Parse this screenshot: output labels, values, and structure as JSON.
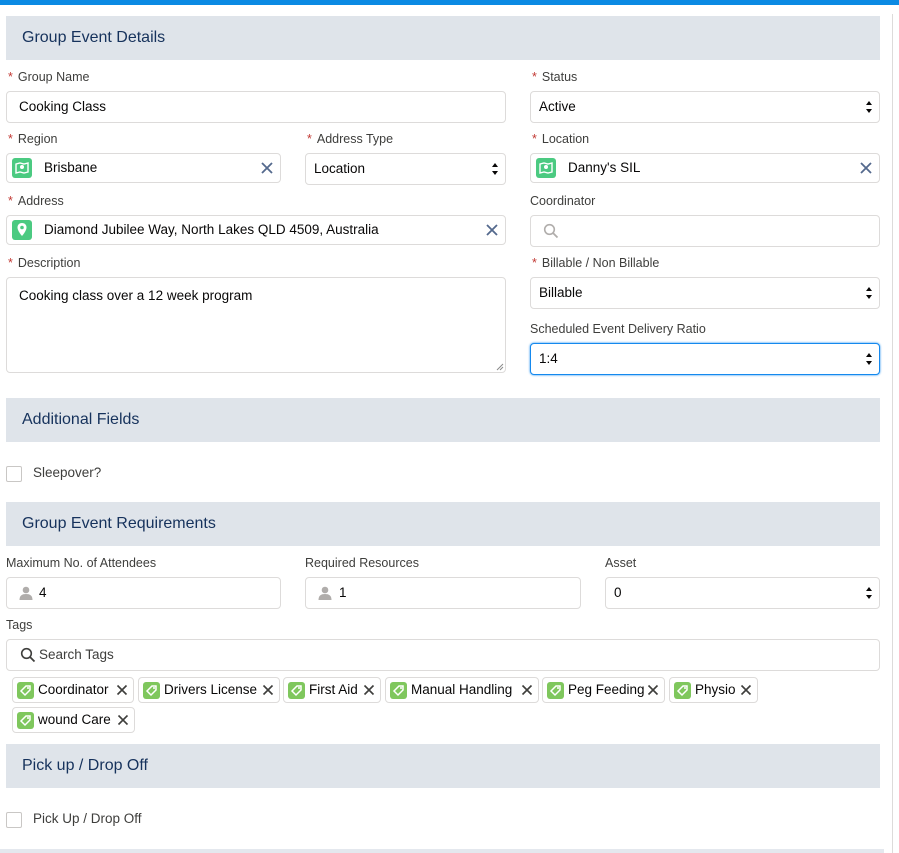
{
  "sections": {
    "group_event_details": "Group Event Details",
    "additional_fields": "Additional Fields",
    "requirements": "Group Event Requirements",
    "pickup": "Pick up / Drop Off"
  },
  "required_marker": "*",
  "group_name": {
    "label": "Group Name",
    "value": "Cooking Class"
  },
  "status": {
    "label": "Status",
    "value": "Active"
  },
  "region": {
    "label": "Region",
    "value": "Brisbane",
    "icon": "location-record-icon"
  },
  "address_type": {
    "label": "Address Type",
    "value": "Location"
  },
  "location": {
    "label": "Location",
    "value": "Danny's SIL",
    "icon": "location-record-icon"
  },
  "address": {
    "label": "Address",
    "value": "Diamond Jubilee Way, North Lakes QLD 4509, Australia",
    "icon": "map-pin-icon"
  },
  "coordinator": {
    "label": "Coordinator",
    "value": ""
  },
  "description": {
    "label": "Description",
    "value": "Cooking class over a 12 week program"
  },
  "billable": {
    "label": "Billable / Non Billable",
    "value": "Billable"
  },
  "delivery_ratio": {
    "label": "Scheduled Event Delivery Ratio",
    "value": "1:4"
  },
  "sleepover": {
    "label": "Sleepover?",
    "checked": false
  },
  "max_attendees": {
    "label": "Maximum No. of Attendees",
    "value": "4"
  },
  "required_resources": {
    "label": "Required Resources",
    "value": "1"
  },
  "asset": {
    "label": "Asset",
    "value": "0"
  },
  "tags": {
    "label": "Tags",
    "placeholder": "Search Tags",
    "items": [
      "Coordinator",
      "Drivers License",
      "First Aid",
      "Manual Handling",
      "Peg Feeding",
      "Physio",
      "wound Care"
    ]
  },
  "pickup_drop": {
    "label": "Pick Up / Drop Off",
    "checked": false
  },
  "colors": {
    "accent": "#0b8ae3",
    "required": "#c23934",
    "record_icon": "#4bca81",
    "tag_icon": "#7fc75d",
    "section_bg": "#dfe4ea"
  }
}
